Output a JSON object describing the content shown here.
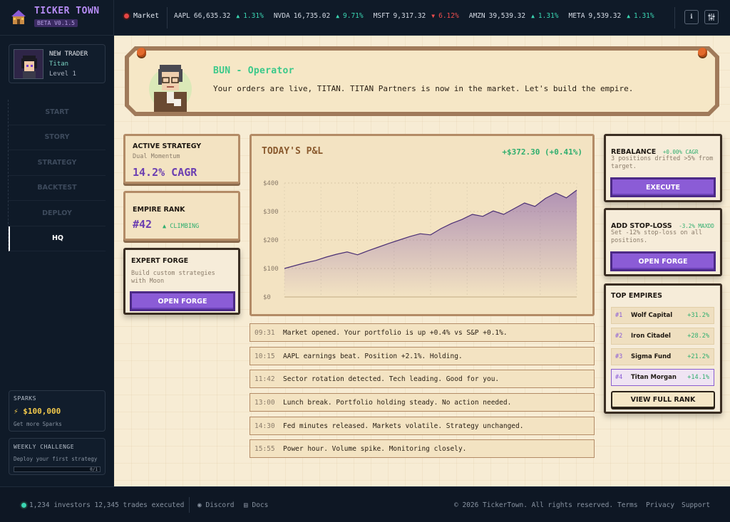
{
  "brand": {
    "title": "TICKER TOWN",
    "version": "BETA V0.1.5"
  },
  "market": {
    "label": "Market",
    "tickers": [
      {
        "symbol": "AAPL",
        "price": "66,635.32",
        "change": "1.31%",
        "dir": "up"
      },
      {
        "symbol": "NVDA",
        "price": "16,735.02",
        "change": "9.71%",
        "dir": "up"
      },
      {
        "symbol": "MSFT",
        "price": "9,317.32",
        "change": "6.12%",
        "dir": "down"
      },
      {
        "symbol": "AMZN",
        "price": "39,539.32",
        "change": "1.31%",
        "dir": "up"
      },
      {
        "symbol": "META",
        "price": "9,539.32",
        "change": "1.31%",
        "dir": "up"
      }
    ]
  },
  "profile": {
    "title": "NEW TRADER",
    "name": "Titan",
    "level": "Level 1"
  },
  "nav": {
    "items": [
      "START",
      "STORY",
      "STRATEGY",
      "BACKTEST",
      "DEPLOY",
      "HQ"
    ],
    "active": "HQ"
  },
  "sparks": {
    "title": "SPARKS",
    "value": "$100,000",
    "sub": "Get more Sparks"
  },
  "weekly": {
    "title": "WEEKLY CHALLENGE",
    "sub": "Deploy your first strategy",
    "progress": "0/1",
    "progress_fraction": 0
  },
  "banner": {
    "speaker": "BUN - Operator",
    "message": "Your orders are live, TITAN. TITAN Partners is now in the market. Let's build the empire."
  },
  "active_strategy": {
    "title": "ACTIVE STRATEGY",
    "name": "Dual Momentum",
    "value": "14.2% CAGR"
  },
  "empire_rank": {
    "title": "EMPIRE RANK",
    "value": "#42",
    "trend": "CLIMBING"
  },
  "expert_forge": {
    "title": "EXPERT FORGE",
    "desc": "Build custom strategies with Moon",
    "button": "OPEN FORGE"
  },
  "pnl": {
    "title": "TODAY'S P&L",
    "value": "+$372.30 (+0.41%)"
  },
  "chart_data": {
    "type": "area",
    "title": "TODAY'S P&L",
    "ylim": [
      0,
      400
    ],
    "yticks": [
      "$0",
      "$100",
      "$200",
      "$300",
      "$400"
    ],
    "grid": true,
    "series": [
      {
        "name": "",
        "values": [
          100,
          110,
          120,
          128,
          140,
          150,
          158,
          148,
          162,
          175,
          188,
          200,
          212,
          222,
          218,
          240,
          258,
          272,
          290,
          283,
          302,
          290,
          310,
          330,
          318,
          346,
          365,
          348,
          375
        ]
      }
    ]
  },
  "log": [
    {
      "time": "09:31",
      "text": "Market opened. Your portfolio is up +0.4% vs S&P +0.1%."
    },
    {
      "time": "10:15",
      "text": "AAPL earnings beat. Position +2.1%. Holding."
    },
    {
      "time": "11:42",
      "text": "Sector rotation detected. Tech leading. Good for you."
    },
    {
      "time": "13:00",
      "text": "Lunch break. Portfolio holding steady. No action needed."
    },
    {
      "time": "14:30",
      "text": "Fed minutes released. Markets volatile. Strategy unchanged."
    },
    {
      "time": "15:55",
      "text": "Power hour. Volume spike. Monitoring closely."
    }
  ],
  "rebalance": {
    "title": "REBALANCE",
    "tag": "+0.00% CAGR",
    "desc": "3 positions drifted >5% from target.",
    "button": "EXECUTE"
  },
  "stoploss": {
    "title": "ADD STOP-LOSS",
    "tag": "-3.2% MAXDD",
    "desc": "Set -12% stop-loss on all positions.",
    "button": "OPEN FORGE"
  },
  "top_empires": {
    "title": "TOP EMPIRES",
    "rows": [
      {
        "rank": "#1",
        "name": "Wolf Capital",
        "pct": "+31.2%"
      },
      {
        "rank": "#2",
        "name": "Iron Citadel",
        "pct": "+28.2%"
      },
      {
        "rank": "#3",
        "name": "Sigma Fund",
        "pct": "+21.2%"
      },
      {
        "rank": "#4",
        "name": "Titan Morgan",
        "pct": "+14.1%"
      }
    ],
    "button": "VIEW FULL RANK"
  },
  "footer": {
    "stats": "1,234 investors 12,345 trades executed",
    "discord": "Discord",
    "docs": "Docs",
    "copyright": "© 2026 TickerTown. All rights reserved.",
    "terms": "Terms",
    "privacy": "Privacy",
    "support": "Support"
  },
  "colors": {
    "accent": "#8b5cd6",
    "up": "#3ad6b3",
    "down": "#ee4d4d",
    "gain": "#2fae6e"
  }
}
